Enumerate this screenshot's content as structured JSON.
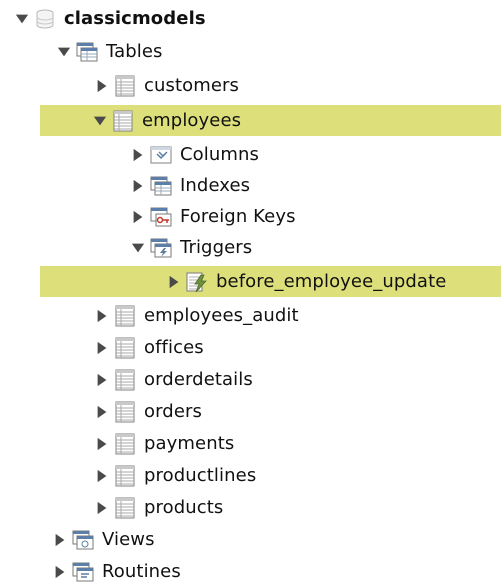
{
  "schema": {
    "name": "classicmodels",
    "groups": {
      "tables": "Tables",
      "views": "Views",
      "routines": "Routines"
    }
  },
  "tables": [
    {
      "name": "customers"
    },
    {
      "name": "employees"
    },
    {
      "name": "employees_audit"
    },
    {
      "name": "offices"
    },
    {
      "name": "orderdetails"
    },
    {
      "name": "orders"
    },
    {
      "name": "payments"
    },
    {
      "name": "productlines"
    },
    {
      "name": "products"
    }
  ],
  "employees_children": {
    "columns": "Columns",
    "indexes": "Indexes",
    "foreign_keys": "Foreign Keys",
    "triggers": "Triggers"
  },
  "trigger": {
    "name": "before_employee_update"
  },
  "colors": {
    "selection": "#dde07a",
    "arrow": "#4a4a4a"
  }
}
